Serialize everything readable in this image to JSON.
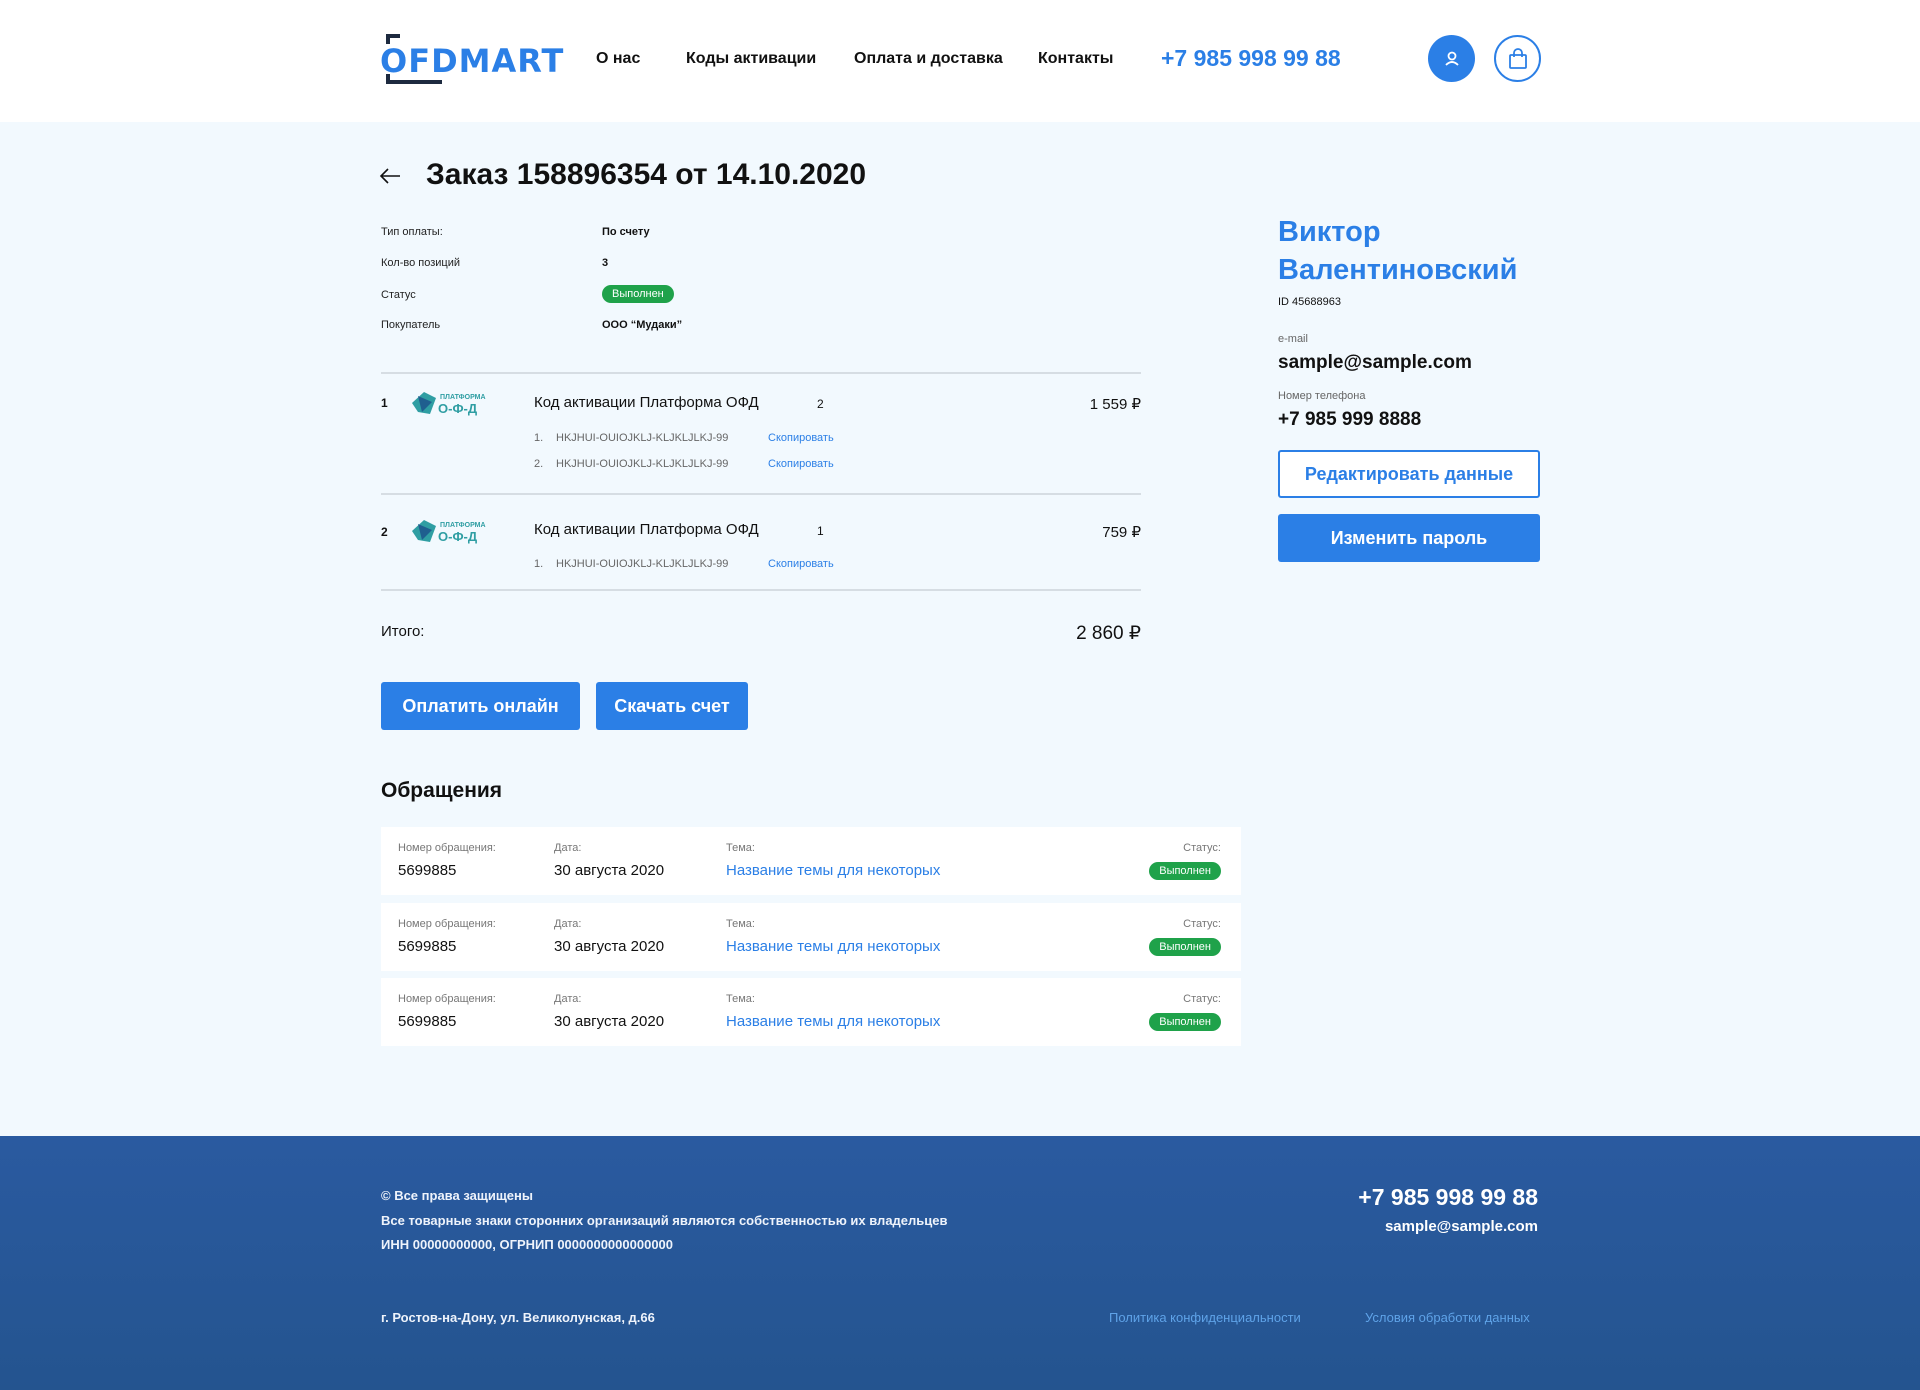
{
  "header": {
    "logo_text": "OFDMART",
    "nav": [
      "О нас",
      "Коды активации",
      "Оплата и доставка",
      "Контакты"
    ],
    "phone": "+7 985 998 99 88"
  },
  "order": {
    "title": "Заказ 158896354 от 14.10.2020",
    "info": [
      {
        "label": "Тип оплаты:",
        "value": "По счету"
      },
      {
        "label": "Кол-во позиций",
        "value": "3"
      },
      {
        "label": "Статус",
        "value": "Выполнен"
      },
      {
        "label": "Покупатель",
        "value": "ООО “Мудаки”"
      }
    ],
    "items": [
      {
        "num": "1",
        "logo_text_top": "ПЛАТФОРМА",
        "logo_text_bottom": "О-Ф-Д",
        "name": "Код активации Платформа ОФД",
        "qty": "2",
        "price": "1 559 ₽",
        "codes": [
          {
            "num": "1.",
            "code": "HKJHUI-OUIOJKLJ-KLJKLJLKJ-99",
            "action": "Скопировать"
          },
          {
            "num": "2.",
            "code": "HKJHUI-OUIOJKLJ-KLJKLJLKJ-99",
            "action": "Скопировать"
          }
        ]
      },
      {
        "num": "2",
        "logo_text_top": "ПЛАТФОРМА",
        "logo_text_bottom": "О-Ф-Д",
        "name": "Код активации Платформа ОФД",
        "qty": "1",
        "price": "759 ₽",
        "codes": [
          {
            "num": "1.",
            "code": "HKJHUI-OUIOJKLJ-KLJKLJLKJ-99",
            "action": "Скопировать"
          }
        ]
      }
    ],
    "total_label": "Итого:",
    "total_value": "2 860 ₽",
    "pay_button": "Оплатить онлайн",
    "invoice_button": "Скачать счет"
  },
  "appeals": {
    "title": "Обращения",
    "labels": {
      "number": "Номер обращения:",
      "date": "Дата:",
      "topic": "Тема:",
      "status": "Статус:"
    },
    "rows": [
      {
        "number": "5699885",
        "date": "30 августа 2020",
        "topic": "Название темы для некоторых",
        "status": "Выполнен"
      },
      {
        "number": "5699885",
        "date": "30 августа 2020",
        "topic": "Название темы для некоторых",
        "status": "Выполнен"
      },
      {
        "number": "5699885",
        "date": "30 августа 2020",
        "topic": "Название темы для некоторых",
        "status": "Выполнен"
      }
    ]
  },
  "profile": {
    "name": "Виктор Валентиновский",
    "id": "ID 45688963",
    "email_label": "e-mail",
    "email": "sample@sample.com",
    "phone_label": "Номер телефона",
    "phone": "+7 985 999 8888",
    "edit_button": "Редактировать данные",
    "password_button": "Изменить пароль"
  },
  "footer": {
    "copyright": "© Все права защищены",
    "trademarks": "Все товарные знаки сторонних организаций являются собственностью их владельцев",
    "inn": "ИНН 00000000000, ОГРНИП 0000000000000000",
    "address": "г. Ростов-на-Дону, ул. Великолунская, д.66",
    "phone": "+7 985 998 99 88",
    "email": "sample@sample.com",
    "privacy_link": "Политика конфиденциальности",
    "terms_link": "Условия обработки данных"
  },
  "colors": {
    "accent": "#2b7fe6",
    "success": "#1fa24a",
    "footer_bg": "#2a5aa0",
    "page_bg": "#f2f9fe"
  },
  "icons": [
    "arrow-left-icon",
    "user-icon",
    "shopping-bag-icon"
  ]
}
